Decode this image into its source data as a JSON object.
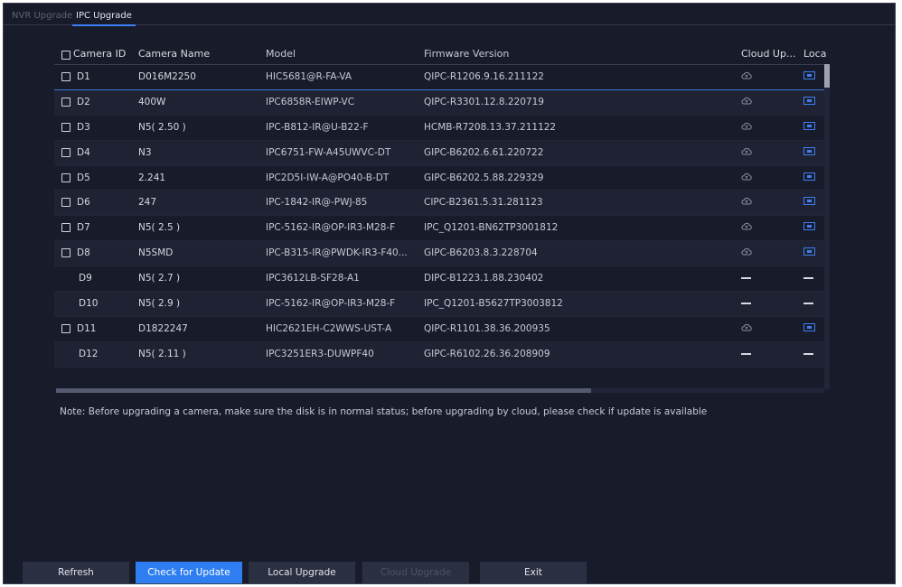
{
  "tabs": [
    {
      "label": "NVR Upgrade",
      "active": false
    },
    {
      "label": "IPC Upgrade",
      "active": true
    }
  ],
  "table": {
    "headers": {
      "camera_id": "Camera ID",
      "camera_name": "Camera Name",
      "model": "Model",
      "firmware": "Firmware Version",
      "cloud": "Cloud Up...",
      "local": "Loca"
    },
    "rows": [
      {
        "id": "D1",
        "name": "D016M2250",
        "model": "HIC5681@R-FA-VA",
        "fw": "QIPC-R1206.9.16.211122",
        "checkbox": true,
        "cloud": "cloud-icon",
        "local": "local-upgrade-icon"
      },
      {
        "id": "D2",
        "name": "400W",
        "model": "IPC6858R-EIWP-VC",
        "fw": "QIPC-R3301.12.8.220719",
        "checkbox": true,
        "cloud": "cloud-icon",
        "local": "local-upgrade-icon"
      },
      {
        "id": "D3",
        "name": "N5( 2.50 )",
        "model": "IPC-B812-IR@U-B22-F",
        "fw": "HCMB-R7208.13.37.211122",
        "checkbox": true,
        "cloud": "cloud-icon",
        "local": "local-upgrade-icon"
      },
      {
        "id": "D4",
        "name": "N3",
        "model": "IPC6751-FW-A45UWVC-DT",
        "fw": "GIPC-B6202.6.61.220722",
        "checkbox": true,
        "cloud": "cloud-icon",
        "local": "local-upgrade-icon"
      },
      {
        "id": "D5",
        "name": "2.241",
        "model": "IPC2D5I-IW-A@PO40-B-DT",
        "fw": "GIPC-B6202.5.88.229329",
        "checkbox": true,
        "cloud": "cloud-icon",
        "local": "local-upgrade-icon"
      },
      {
        "id": "D6",
        "name": "247",
        "model": "IPC-1842-IR@-PWJ-85",
        "fw": "CIPC-B2361.5.31.281123",
        "checkbox": true,
        "cloud": "cloud-icon",
        "local": "local-upgrade-icon"
      },
      {
        "id": "D7",
        "name": "N5( 2.5 )",
        "model": "IPC-5162-IR@OP-IR3-M28-F",
        "fw": "IPC_Q1201-BN62TP3001812",
        "checkbox": true,
        "cloud": "cloud-icon",
        "local": "local-upgrade-icon"
      },
      {
        "id": "D8",
        "name": "N5SMD",
        "model": "IPC-B315-IR@PWDK-IR3-F40...",
        "fw": "GIPC-B6203.8.3.228704",
        "checkbox": true,
        "cloud": "cloud-icon",
        "local": "local-upgrade-icon"
      },
      {
        "id": "D9",
        "name": "N5( 2.7 )",
        "model": "IPC3612LB-SF28-A1",
        "fw": "DIPC-B1223.1.88.230402",
        "checkbox": false,
        "cloud": "dash",
        "local": "dash"
      },
      {
        "id": "D10",
        "name": "N5( 2.9 )",
        "model": "IPC-5162-IR@OP-IR3-M28-F",
        "fw": "IPC_Q1201-B5627TP3003812",
        "checkbox": false,
        "cloud": "dash",
        "local": "dash"
      },
      {
        "id": "D11",
        "name": "D1822247",
        "model": "HIC2621EH-C2WWS-UST-A",
        "fw": "QIPC-R1101.38.36.200935",
        "checkbox": true,
        "cloud": "cloud-icon",
        "local": "local-upgrade-icon"
      },
      {
        "id": "D12",
        "name": "N5( 2.11 )",
        "model": "IPC3251ER3-DUWPF40",
        "fw": "GIPC-R6102.26.36.208909",
        "checkbox": false,
        "cloud": "dash",
        "local": "dash"
      }
    ]
  },
  "note": "Note: Before upgrading a camera, make sure the disk is in normal status; before upgrading by cloud, please check if update is available",
  "buttons": {
    "refresh": "Refresh",
    "check": "Check for Update",
    "local": "Local Upgrade",
    "cloud": "Cloud Upgrade",
    "exit": "Exit"
  },
  "colors": {
    "background": "#181b2a",
    "accent": "#2e7ef2",
    "text": "#d6d8e2"
  }
}
